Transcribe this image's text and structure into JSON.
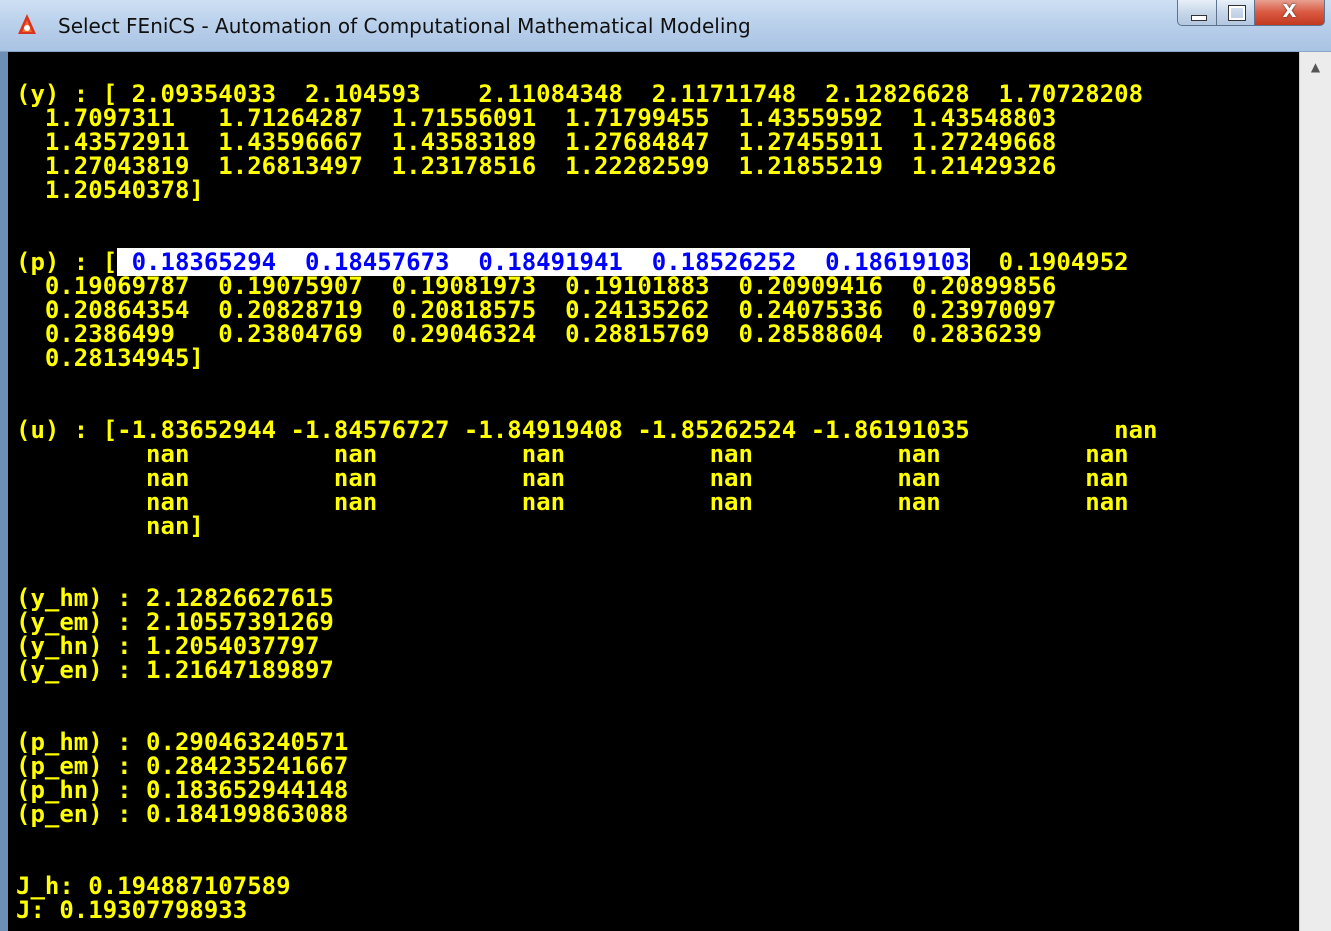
{
  "window": {
    "title": "Select FEniCS - Automation of Computational Mathematical Modeling",
    "icon": "fenics-logo-icon",
    "buttons": {
      "minimize": "minimize-icon",
      "maximize": "maximize-icon",
      "close": "X"
    }
  },
  "console": {
    "lines": [
      [
        "(y) : [ 2.09354033  2.104593    2.11084348  2.11711748  2.12826628  1.70728208"
      ],
      [
        "  1.7097311   1.71264287  1.71556091  1.71799455  1.43559592  1.43548803"
      ],
      [
        "  1.43572911  1.43596667  1.43583189  1.27684847  1.27455911  1.27249668"
      ],
      [
        "  1.27043819  1.26813497  1.23178516  1.22282599  1.21855219  1.21429326"
      ],
      [
        "  1.20540378]"
      ],
      [
        ""
      ],
      [
        ""
      ],
      [
        "(p) : [",
        " 0.18365294  0.18457673  0.18491941  0.18526252  0.18619103",
        "  0.1904952"
      ],
      [
        "  0.19069787  0.19075907  0.19081973  0.19101883  0.20909416  0.20899856"
      ],
      [
        "  0.20864354  0.20828719  0.20818575  0.24135262  0.24075336  0.23970097"
      ],
      [
        "  0.2386499   0.23804769  0.29046324  0.28815769  0.28588604  0.2836239"
      ],
      [
        "  0.28134945]"
      ],
      [
        ""
      ],
      [
        ""
      ],
      [
        "(u) : [-1.83652944 -1.84576727 -1.84919408 -1.85262524 -1.86191035          nan"
      ],
      [
        "         nan          nan          nan          nan          nan          nan"
      ],
      [
        "         nan          nan          nan          nan          nan          nan"
      ],
      [
        "         nan          nan          nan          nan          nan          nan"
      ],
      [
        "         nan]"
      ],
      [
        ""
      ],
      [
        ""
      ],
      [
        "(y_hm) : 2.12826627615"
      ],
      [
        "(y_em) : 2.10557391269"
      ],
      [
        "(y_hn) : 1.2054037797"
      ],
      [
        "(y_en) : 1.21647189897"
      ],
      [
        ""
      ],
      [
        ""
      ],
      [
        "(p_hm) : 0.290463240571"
      ],
      [
        "(p_em) : 0.284235241667"
      ],
      [
        "(p_hn) : 0.183652944148"
      ],
      [
        "(p_en) : 0.184199863088"
      ],
      [
        ""
      ],
      [
        ""
      ],
      [
        "J_h: 0.194887107589"
      ],
      [
        "J: 0.19307798933"
      ]
    ]
  },
  "scrollbar": {
    "up_arrow": "▲"
  }
}
